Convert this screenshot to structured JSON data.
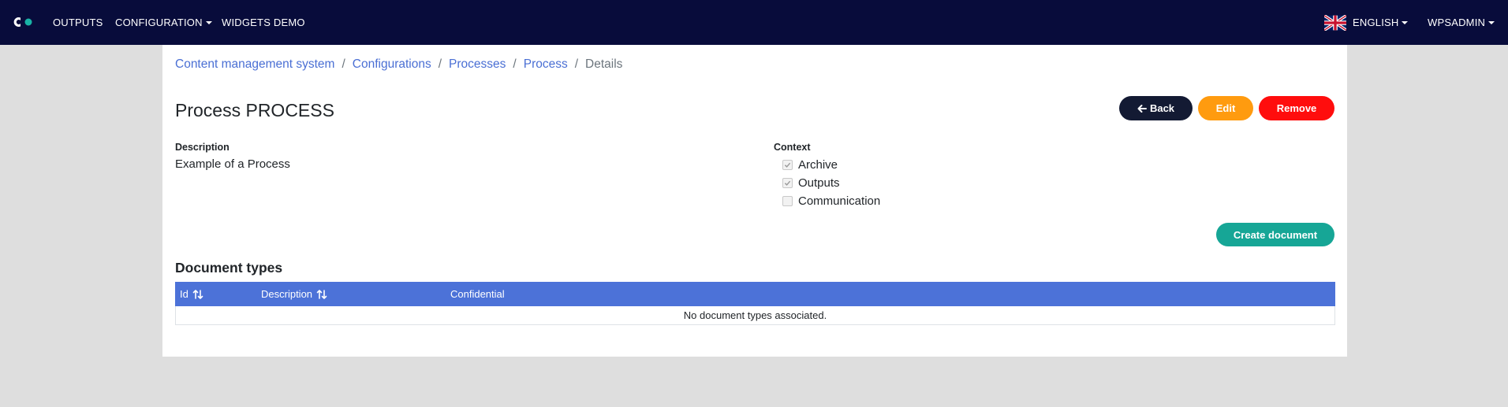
{
  "navbar": {
    "logo_name": "app-logo",
    "items": [
      {
        "label": "OUTPUTS",
        "dropdown": false
      },
      {
        "label": "CONFIGURATION",
        "dropdown": true
      },
      {
        "label": "WIDGETS DEMO",
        "dropdown": false
      }
    ],
    "language": {
      "label": "ENGLISH",
      "flag_icon": "uk-flag-icon"
    },
    "user": {
      "label": "WPSADMIN"
    },
    "colors": {
      "background": "#080c3b",
      "logo_accent": "#19b3a6"
    }
  },
  "breadcrumb": {
    "items": [
      "Content management system",
      "Configurations",
      "Processes",
      "Process"
    ],
    "separator": "/",
    "active": "Details"
  },
  "page": {
    "title": "Process PROCESS"
  },
  "actions": {
    "back_label": "Back",
    "back_icon": "arrow-left-icon",
    "edit_label": "Edit",
    "remove_label": "Remove",
    "create_document_label": "Create document",
    "colors": {
      "back": "#131a33",
      "edit": "#ff9b0f",
      "remove": "#ff0d0d",
      "create": "#16a696"
    }
  },
  "details": {
    "description_label": "Description",
    "description_value": "Example of a Process",
    "context_label": "Context",
    "context_options": [
      {
        "label": "Archive",
        "checked": true
      },
      {
        "label": "Outputs",
        "checked": true
      },
      {
        "label": "Communication",
        "checked": false
      }
    ]
  },
  "document_types": {
    "title": "Document types",
    "columns": [
      {
        "label": "Id",
        "sortable": true
      },
      {
        "label": "Description",
        "sortable": true
      },
      {
        "label": "Confidential",
        "sortable": false
      }
    ],
    "empty_message": "No document types associated.",
    "header_color": "#4c72d8"
  }
}
